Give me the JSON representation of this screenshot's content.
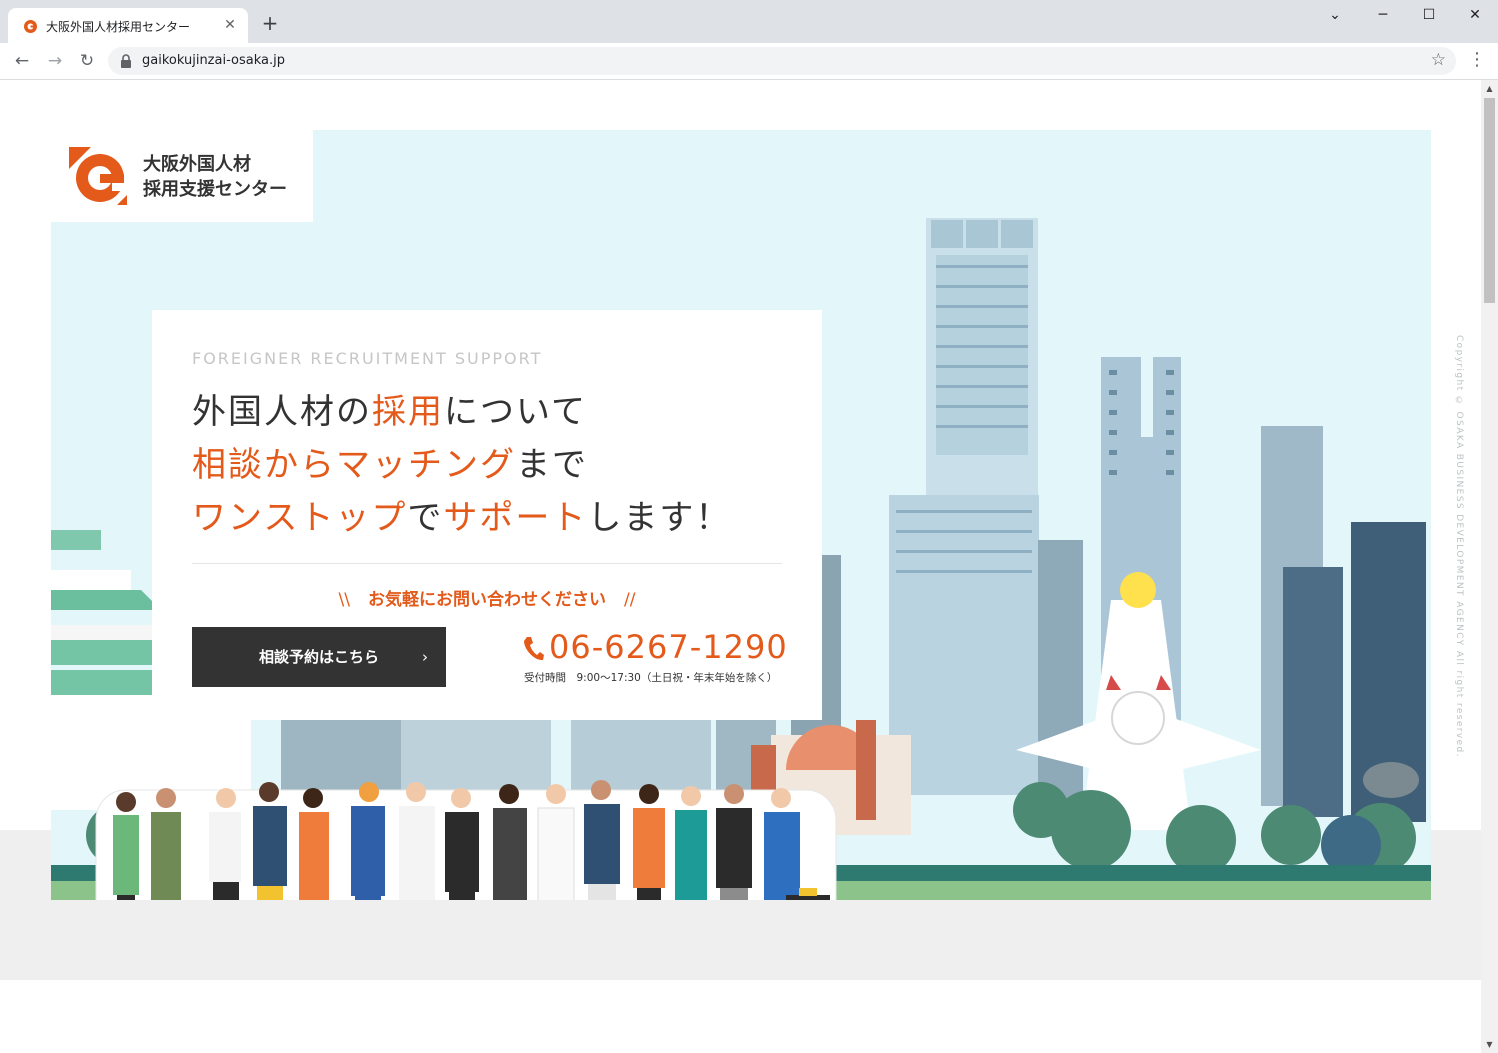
{
  "browser": {
    "tab_title": "大阪外国人材採用センター",
    "tab_close": "✕",
    "new_tab": "+",
    "url": "gaikokujinzai-osaka.jp",
    "window_controls": {
      "chevron": "⌄",
      "minimize": "─",
      "maximize": "☐",
      "close": "✕"
    },
    "nav": {
      "back": "←",
      "forward": "→",
      "reload": "↻",
      "bookmark": "☆",
      "menu": "⋮"
    }
  },
  "header": {
    "logo_line1": "大阪外国人材",
    "logo_line2": "採用支援センター"
  },
  "hero": {
    "eyebrow": "FOREIGNER RECRUITMENT SUPPORT",
    "headline": {
      "l1a": "外国人材の",
      "l1b": "採用",
      "l1c": "について",
      "l2a": "相談からマッチング",
      "l2b": "まで",
      "l3a": "ワンストップ",
      "l3b": "で",
      "l3c": "サポート",
      "l3d": "します！"
    },
    "cta_note": "お気軽にお問い合わせください",
    "slash_left": "\\\\",
    "slash_right": "//",
    "cta_button": "相談予約はこちら",
    "cta_chevron": "›",
    "phone": "06-6267-1290",
    "hours": "受付時間　9:00～17:30（土日祝・年末年始を除く）"
  },
  "copyright": "Copyright © OSAKA BUSINESS DEVELOPMENT AGENCY All right reserved.",
  "colors": {
    "accent": "#e35a1b",
    "dark": "#333333",
    "sky": "#e3f7fb",
    "grass": "#8cc38a"
  }
}
